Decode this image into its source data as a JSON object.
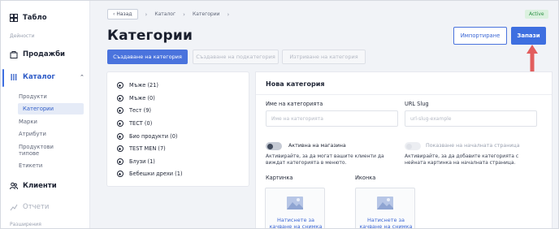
{
  "sidebar": {
    "dashboard": "Табло",
    "section_activity": "Дейности",
    "sales": "Продажби",
    "catalog": "Каталог",
    "catalog_items": [
      "Продукти",
      "Категории",
      "Марки",
      "Атрибути",
      "Продуктови типове",
      "Етикети"
    ],
    "clients": "Клиенти",
    "reports": "Отчети",
    "section_extensions": "Разширения"
  },
  "header": {
    "back": "Назад",
    "crumb_1": "Каталог",
    "crumb_2": "Категории",
    "status": "Active",
    "title": "Категории",
    "import_label": "Импортиране",
    "save_label": "Запази"
  },
  "tabs": [
    "Създаване на категория",
    "Създаване на подкатегория",
    "Изтриване на категория"
  ],
  "categories": [
    "Мъже (21)",
    "Мъже (0)",
    "Тест (9)",
    "ТЕСТ (0)",
    "Био продукти (0)",
    "TEST MEN (7)",
    "Блузи (1)",
    "Бебешки дрехи (1)"
  ],
  "form": {
    "title": "Нова категория",
    "name_label": "Име на категорията",
    "name_placeholder": "Име на категорията",
    "slug_label": "URL Slug",
    "slug_placeholder": "url-slug-example",
    "store_toggle_label": "Активна на магазина",
    "store_hint": "Активирайте, за да могат вашите клиенти да виждат категорията в менюто.",
    "home_toggle_label": "Показване на началната страница",
    "home_hint": "Активирайте, за да добавите категорията с нейната картинка на началната страница.",
    "picture_label": "Картинка",
    "icon_label": "Иконка",
    "upload_text": "Натиснете за качване на снимка"
  },
  "colors": {
    "accent": "#3e6fe0",
    "badge_bg": "#dbf1df",
    "badge_text": "#2e9146",
    "arrow": "#e25d5d"
  }
}
